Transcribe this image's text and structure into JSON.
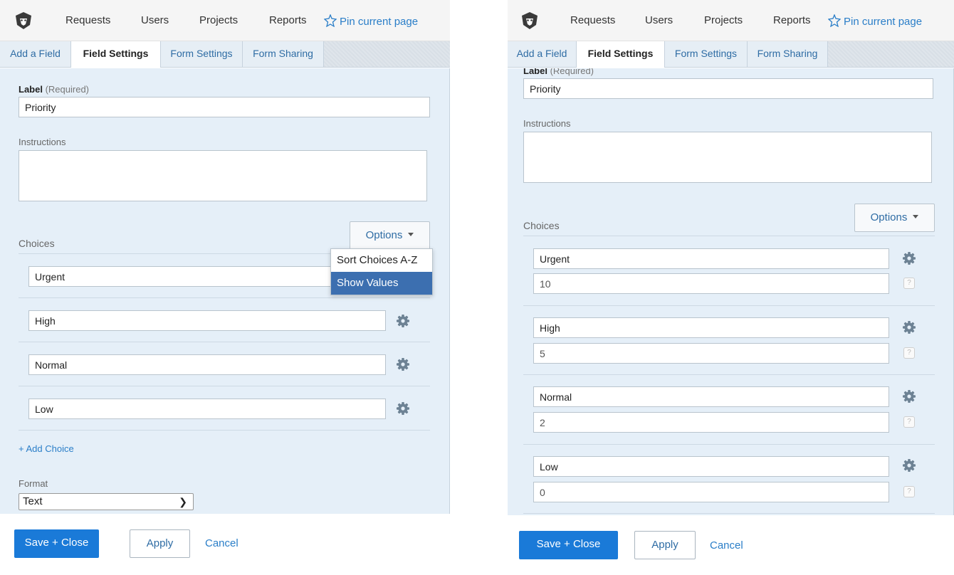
{
  "nav": {
    "items": [
      "Requests",
      "Users",
      "Projects",
      "Reports"
    ],
    "pin_label": "Pin current page"
  },
  "tabs": [
    "Add a Field",
    "Field Settings",
    "Form Settings",
    "Form Sharing"
  ],
  "active_tab": "Field Settings",
  "form": {
    "label_title": "Label",
    "label_required": "(Required)",
    "label_value": "Priority",
    "instructions_title": "Instructions",
    "choices_title": "Choices",
    "options_button": "Options",
    "add_choice": "+ Add Choice",
    "format_title": "Format",
    "format_value": "Text"
  },
  "options_menu": [
    "Sort Choices A-Z",
    "Show Values"
  ],
  "choices": [
    {
      "label": "Urgent",
      "value": "10"
    },
    {
      "label": "High",
      "value": "5"
    },
    {
      "label": "Normal",
      "value": "2"
    },
    {
      "label": "Low",
      "value": "0"
    }
  ],
  "help_glyph": "?",
  "footer": {
    "save_close": "Save + Close",
    "apply": "Apply",
    "cancel": "Cancel"
  },
  "colors": {
    "primary": "#1a7ad8",
    "link": "#2a7ec8",
    "panel_bg": "#e5eff8",
    "menu_highlight": "#3c6fb0"
  }
}
